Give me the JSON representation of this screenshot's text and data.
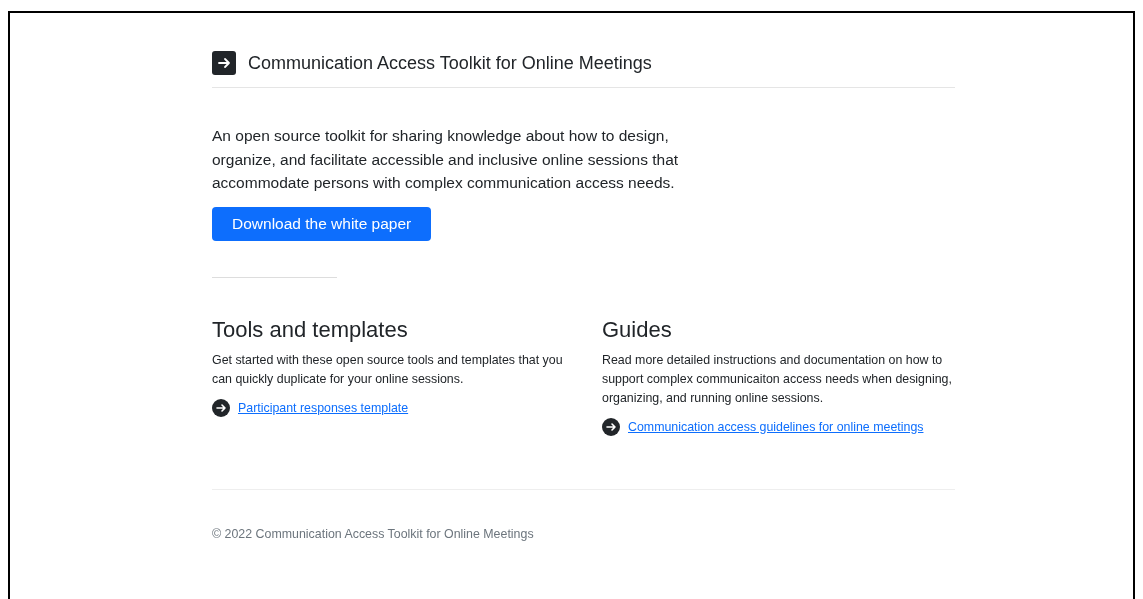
{
  "header": {
    "title": "Communication Access Toolkit for Online Meetings"
  },
  "hero": {
    "text": "An open source toolkit for sharing knowledge about how to design, organize, and facilitate accessible and inclusive online sessions that accommodate persons with complex communication access needs.",
    "button": "Download the white paper"
  },
  "sections": [
    {
      "title": "Tools and templates",
      "text": "Get started with these open source tools and templates that you can quickly duplicate for your online sessions.",
      "links": [
        "Participant responses template"
      ]
    },
    {
      "title": "Guides",
      "text": "Read more detailed instructions and documentation on how to support complex communicaiton access needs when designing, organizing, and running online sessions.",
      "links": [
        "Communication access guidelines for online meetings"
      ]
    }
  ],
  "footer": {
    "text": "© 2022 Communication Access Toolkit for Online Meetings"
  }
}
